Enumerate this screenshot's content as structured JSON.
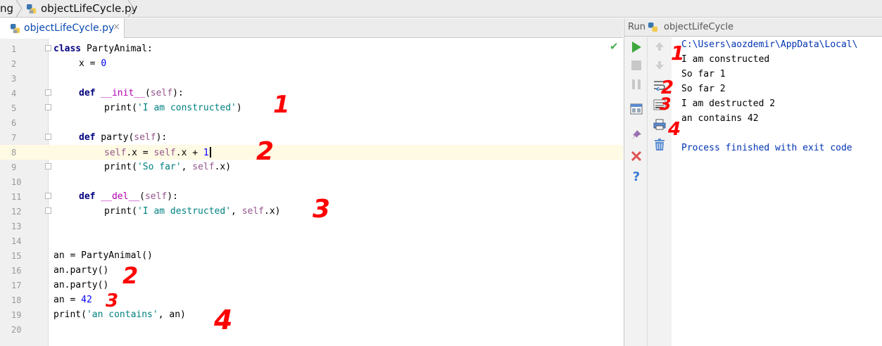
{
  "breadcrumb": {
    "items": [
      "ng",
      "objectLifeCycle.py"
    ]
  },
  "editor_tab": {
    "label": "objectLifeCycle.py",
    "close": "×"
  },
  "editor": {
    "line_numbers": [
      "1",
      "2",
      "3",
      "4",
      "5",
      "6",
      "7",
      "8",
      "9",
      "10",
      "11",
      "12",
      "13",
      "14",
      "15",
      "16",
      "17",
      "18",
      "19",
      "20"
    ],
    "current_line": "8",
    "code": {
      "l1_kw": "class",
      "l1_rest": " PartyAnimal:",
      "l2_a": "x = ",
      "l2_num": "0",
      "l4_kw": "def",
      "l4_name": " __init__",
      "l4_a": "(",
      "l4_self": "self",
      "l4_b": "):",
      "l5_a": "print(",
      "l5_str": "'I am constructed'",
      "l5_b": ")",
      "l7_kw": "def",
      "l7_a": " party(",
      "l7_self": "self",
      "l7_b": "):",
      "l8_self1": "self",
      "l8_a": ".x = ",
      "l8_self2": "self",
      "l8_b": ".x + ",
      "l8_num": "1",
      "l9_a": "print(",
      "l9_str": "'So far'",
      "l9_b": ", ",
      "l9_self": "self",
      "l9_c": ".x)",
      "l11_kw": "def",
      "l11_name": " __del__",
      "l11_a": "(",
      "l11_self": "self",
      "l11_b": "):",
      "l12_a": "print(",
      "l12_str": "'I am destructed'",
      "l12_b": ", ",
      "l12_self": "self",
      "l12_c": ".x)",
      "l15": "an = PartyAnimal()",
      "l16": "an.party()",
      "l17": "an.party()",
      "l18_a": "an = ",
      "l18_num": "42",
      "l19_a": "print(",
      "l19_str": "'an contains'",
      "l19_b": ", an)"
    },
    "annotations": [
      "1",
      "2",
      "3",
      "2",
      "3",
      "4"
    ]
  },
  "run_panel": {
    "header_label": "Run",
    "config_name": "objectLifeCycle",
    "annotations": [
      "1",
      "2",
      "3",
      "4"
    ],
    "console_lines": [
      "C:\\Users\\aozdemir\\AppData\\Local\\",
      "I am constructed",
      "So far 1",
      "So far 2",
      "I am destructed 2",
      "an contains 42",
      "",
      "Process finished with exit code"
    ]
  },
  "colors": {
    "keyword": "#000080",
    "string": "#008080",
    "number": "#0000ff",
    "self": "#94558d",
    "magic": "#b200b2",
    "annotation": "#ff0000",
    "current_line": "#fffae3"
  },
  "icons": {
    "run": "play-icon",
    "stop": "stop-icon",
    "pause": "pause-icon",
    "up": "arrow-up-icon",
    "down": "arrow-down-icon",
    "soft_wrap": "soft-wrap-icon",
    "scroll_end": "scroll-to-end-icon",
    "print": "print-icon",
    "trash": "trash-icon",
    "layout": "layout-icon",
    "pin": "pin-icon",
    "close": "close-icon",
    "help": "help-icon",
    "check": "check-icon"
  }
}
